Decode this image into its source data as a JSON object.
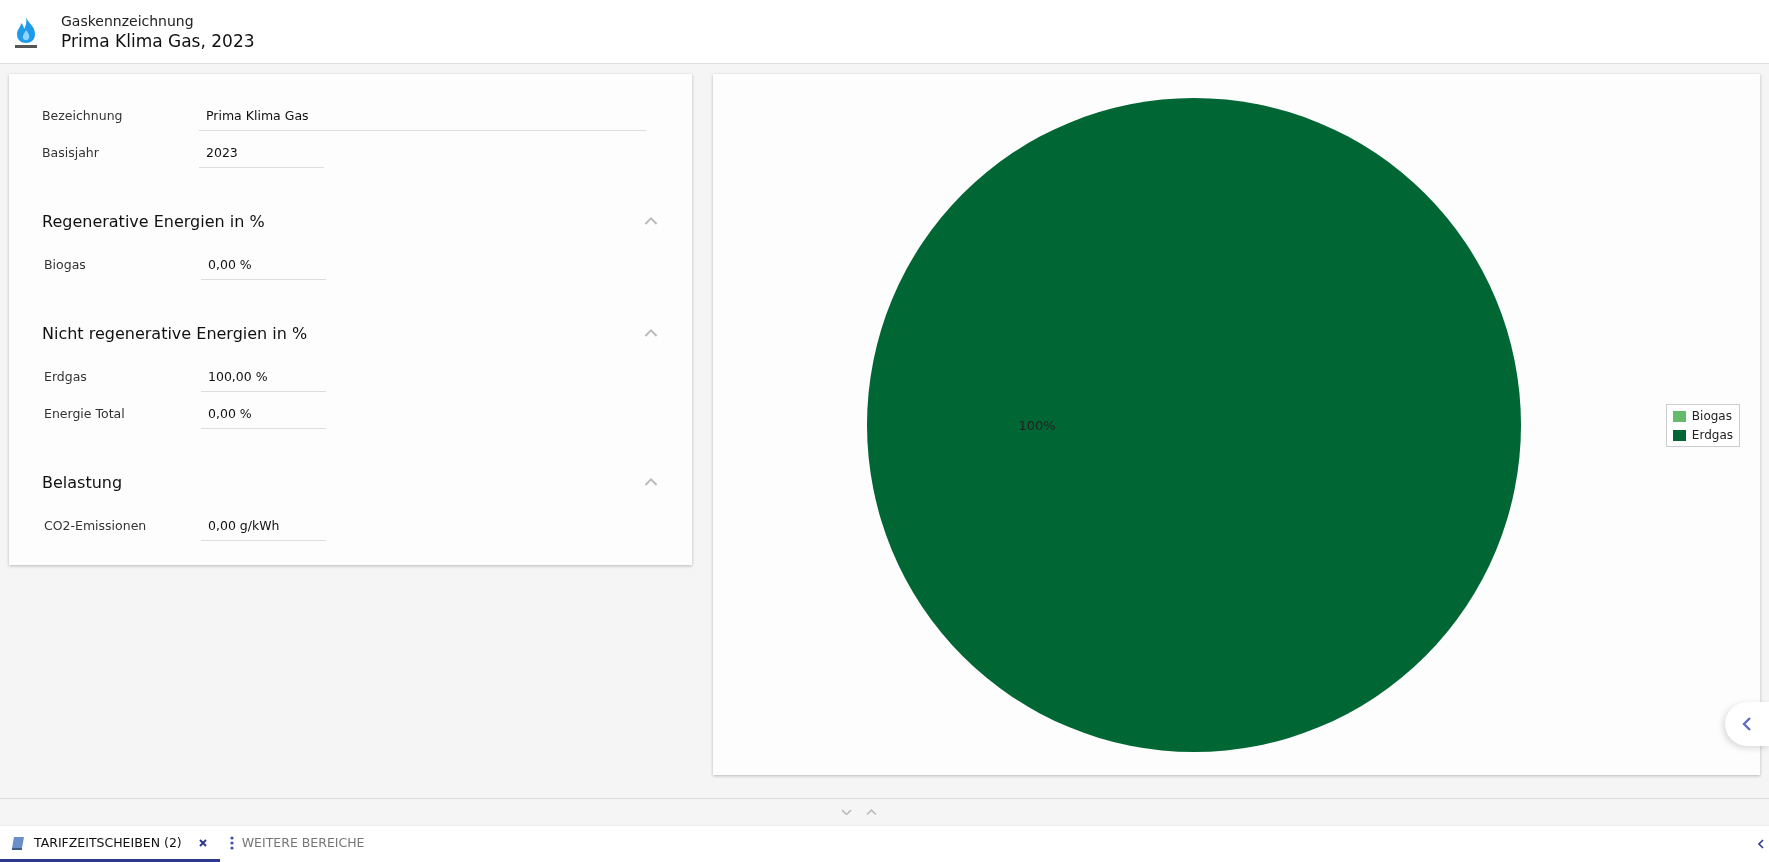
{
  "header": {
    "subtitle": "Gaskennzeichnung",
    "title": "Prima Klima Gas, 2023"
  },
  "form": {
    "fields": [
      {
        "label": "Bezeichnung",
        "value": "Prima Klima Gas",
        "wide": true
      },
      {
        "label": "Basisjahr",
        "value": "2023",
        "wide": false
      }
    ],
    "sections": [
      {
        "title": "Regenerative Energien in %",
        "expanded": true,
        "fields": [
          {
            "label": "Biogas",
            "value": "0,00 %"
          }
        ]
      },
      {
        "title": "Nicht regenerative Energien in %",
        "expanded": true,
        "fields": [
          {
            "label": "Erdgas",
            "value": "100,00 %"
          },
          {
            "label": "Energie Total",
            "value": "0,00 %"
          }
        ]
      },
      {
        "title": "Belastung",
        "expanded": true,
        "fields": [
          {
            "label": "CO2-Emissionen",
            "value": "0,00 g/kWh"
          }
        ]
      }
    ]
  },
  "chart": {
    "chart_data": {
      "type": "pie",
      "categories": [
        "Biogas",
        "Erdgas"
      ],
      "values": [
        0,
        100
      ],
      "colors": [
        "#66bb6a",
        "#006633"
      ],
      "value_labels": [
        null,
        "100%"
      ]
    }
  },
  "bottom_tabs": [
    {
      "label": "TARIFZEITSCHEIBEN (2)",
      "selected": true,
      "closable": true
    },
    {
      "label": "WEITERE BEREICHE",
      "selected": false,
      "closable": false
    }
  ]
}
